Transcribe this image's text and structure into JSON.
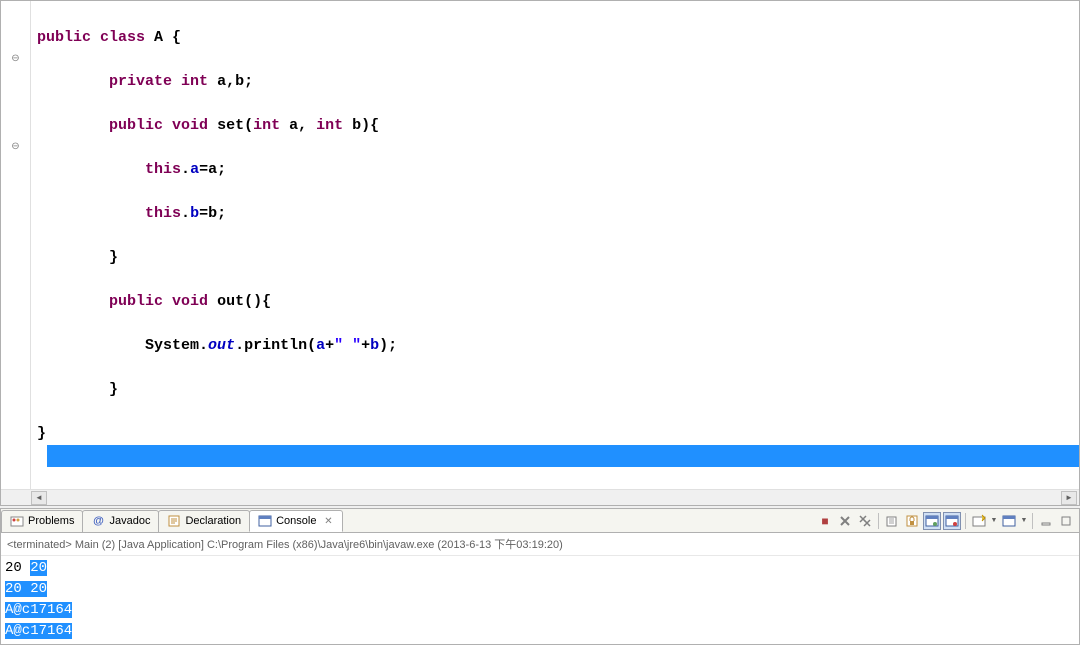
{
  "editor": {
    "fold_markers": {
      "line3": "⊖",
      "line8": "⊖"
    },
    "code": {
      "l1_kw1": "public",
      "l1_kw2": "class",
      "l1_name": " A {",
      "l2_kw1": "private",
      "l2_kw2": "int",
      "l2_rest": " a,b;",
      "l3_kw1": "public",
      "l3_kw2": "void",
      "l3_name": " set(",
      "l3_kw3": "int",
      "l3_p1": " a, ",
      "l3_kw4": "int",
      "l3_p2": " b){",
      "l4_kw": "this",
      "l4_dot": ".",
      "l4_field": "a",
      "l4_rest": "=a;",
      "l5_kw": "this",
      "l5_dot": ".",
      "l5_field": "b",
      "l5_rest": "=b;",
      "l6": "}",
      "l7_kw1": "public",
      "l7_kw2": "void",
      "l7_rest": " out(){",
      "l8_sys": "System.",
      "l8_out": "out",
      "l8_print": ".println(",
      "l8_a": "a",
      "l8_plus1": "+",
      "l8_str": "\" \"",
      "l8_plus2": "+",
      "l8_b": "b",
      "l8_end": ");",
      "l9": "}",
      "l10": "}"
    }
  },
  "tabs": {
    "problems": "Problems",
    "javadoc": "Javadoc",
    "declaration": "Declaration",
    "console": "Console"
  },
  "console": {
    "header": "<terminated> Main (2) [Java Application] C:\\Program Files (x86)\\Java\\jre6\\bin\\javaw.exe (2013-6-13 下午03:19:20)",
    "line1_a": "20 ",
    "line1_b": "20",
    "line2": "20 20",
    "line3": "A@c17164",
    "line4": "A@c17164"
  },
  "toolbar_icons": {
    "terminate": "■",
    "remove": "✖",
    "remove_all": "✖",
    "scroll_lock": "🔒",
    "clear": "📋",
    "pin": "📌",
    "display": "🖥",
    "open": "📂",
    "min": "▭",
    "max": "▢"
  }
}
